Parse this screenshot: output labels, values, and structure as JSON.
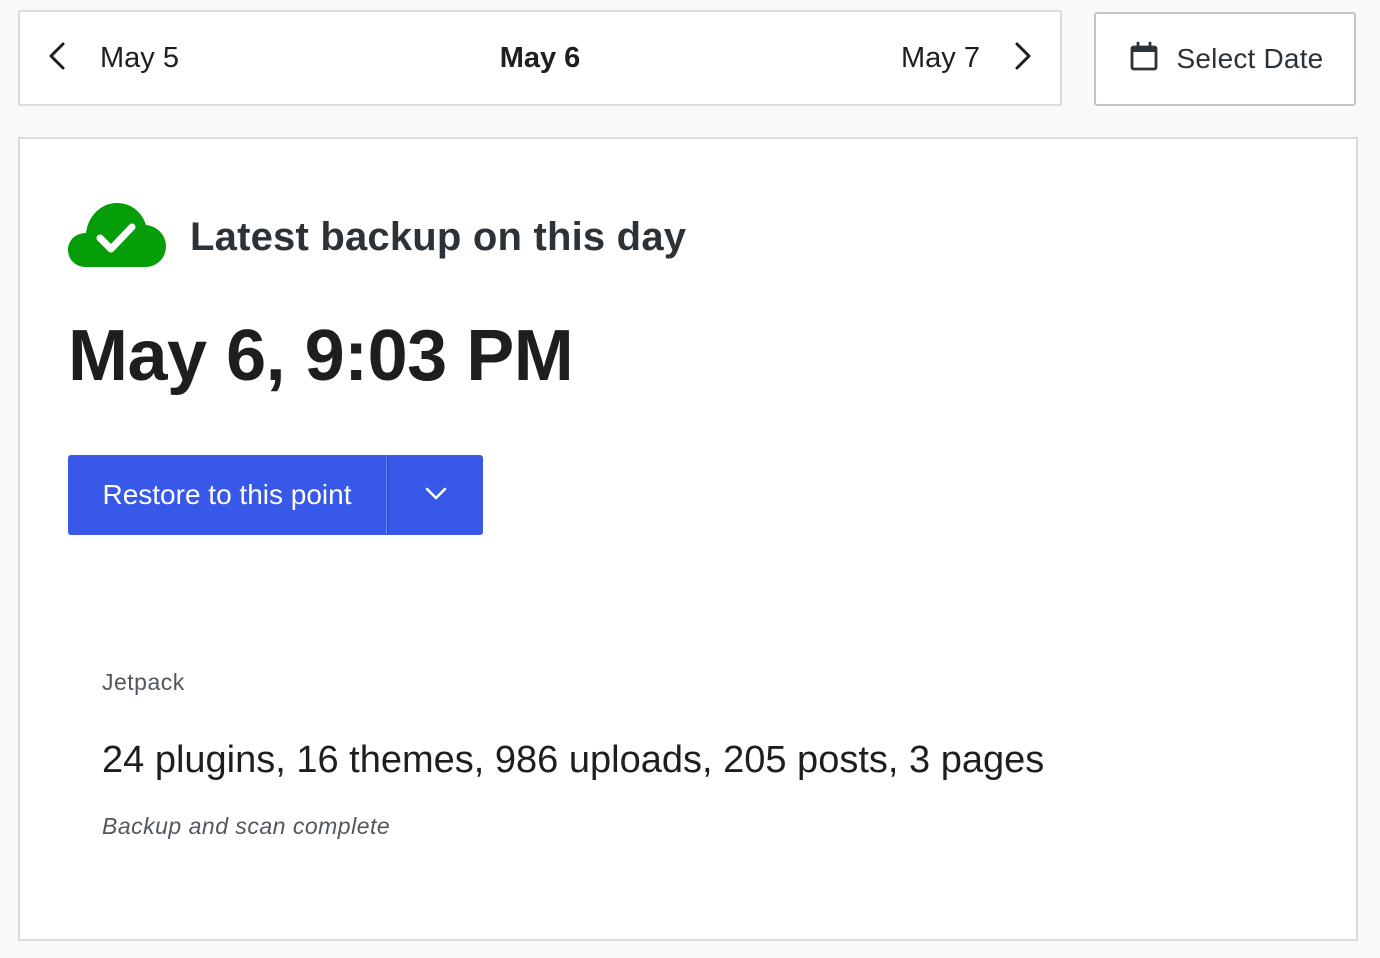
{
  "date_nav": {
    "previous_label": "May 5",
    "current_label": "May 6",
    "next_label": "May 7"
  },
  "select_date": {
    "label": "Select Date"
  },
  "backup": {
    "status_title": "Latest backup on this day",
    "timestamp": "May 6, 9:03 PM",
    "restore_label": "Restore to this point",
    "source": "Jetpack",
    "summary": "24 plugins, 16 themes, 986 uploads, 205 posts, 3 pages",
    "scan_status": "Backup and scan complete"
  },
  "icons": {
    "previous": "chevron-left-icon",
    "next": "chevron-right-icon",
    "calendar": "calendar-icon",
    "status": "cloud-check-icon",
    "dropdown": "chevron-down-icon"
  },
  "colors": {
    "accent": "#3858e9",
    "success": "#069e08",
    "text": "#1e1e1e",
    "muted": "#50575e"
  }
}
